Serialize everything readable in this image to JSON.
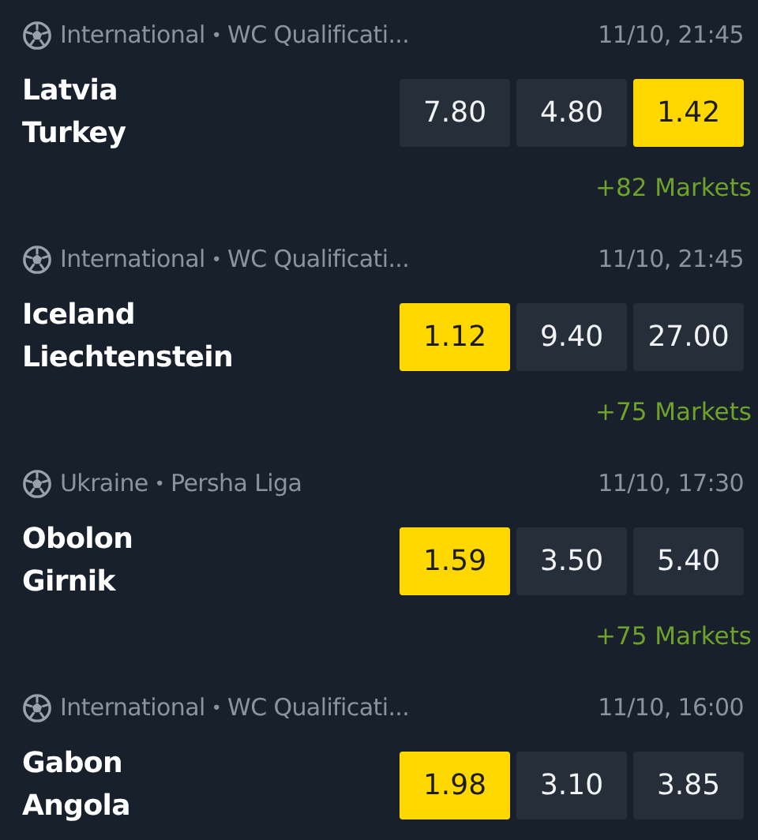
{
  "matches": [
    {
      "league": "International",
      "separator": "•",
      "competition": "WC Qualificati...",
      "time": "11/10, 21:45",
      "home": "Latvia",
      "away": "Turkey",
      "odds": [
        {
          "value": "7.80",
          "selected": false
        },
        {
          "value": "4.80",
          "selected": false
        },
        {
          "value": "1.42",
          "selected": true
        }
      ],
      "markets": "+82 Markets"
    },
    {
      "league": "International",
      "separator": "•",
      "competition": "WC Qualificati...",
      "time": "11/10, 21:45",
      "home": "Iceland",
      "away": "Liechtenstein",
      "odds": [
        {
          "value": "1.12",
          "selected": true
        },
        {
          "value": "9.40",
          "selected": false
        },
        {
          "value": "27.00",
          "selected": false
        }
      ],
      "markets": "+75 Markets"
    },
    {
      "league": "Ukraine",
      "separator": "•",
      "competition": "Persha Liga",
      "time": "11/10, 17:30",
      "home": "Obolon",
      "away": "Girnik",
      "odds": [
        {
          "value": "1.59",
          "selected": true
        },
        {
          "value": "3.50",
          "selected": false
        },
        {
          "value": "5.40",
          "selected": false
        }
      ],
      "markets": "+75 Markets"
    },
    {
      "league": "International",
      "separator": "•",
      "competition": "WC Qualificati...",
      "time": "11/10, 16:00",
      "home": "Gabon",
      "away": "Angola",
      "odds": [
        {
          "value": "1.98",
          "selected": true
        },
        {
          "value": "3.10",
          "selected": false
        },
        {
          "value": "3.85",
          "selected": false
        }
      ]
    }
  ]
}
